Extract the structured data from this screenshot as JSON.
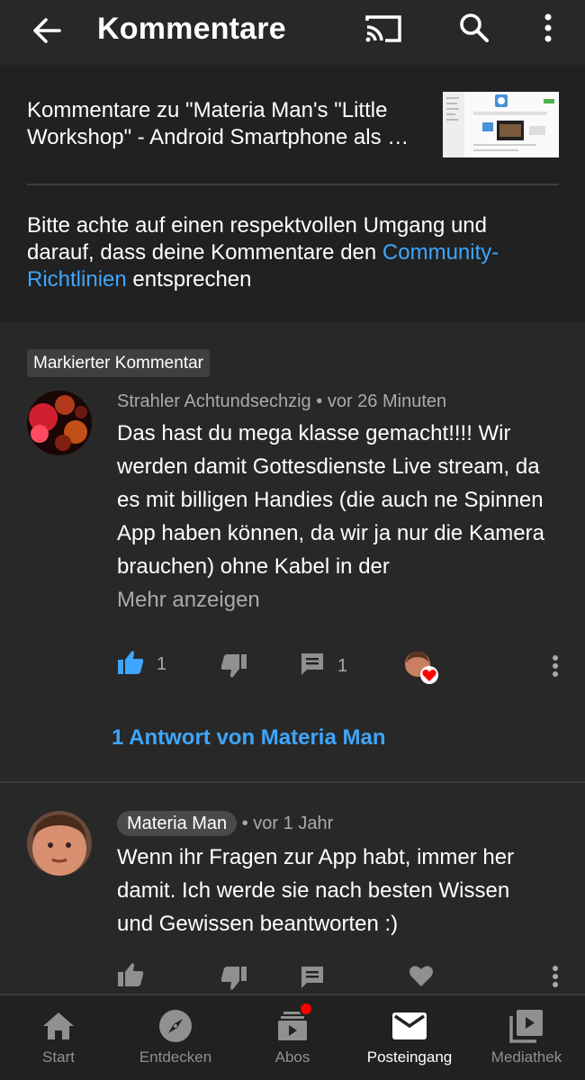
{
  "appbar": {
    "title": "Kommentare"
  },
  "header": {
    "video_ref": "Kommentare zu \"Materia Man's \"Little Workshop\" - Android Smartphone als …",
    "notice_prefix": "Bitte achte auf einen respektvollen Umgang und darauf, dass deine Kommentare den ",
    "notice_link": "Community-Richtlinien",
    "notice_suffix": " entsprechen"
  },
  "pinned_badge": "Markierter Kommentar",
  "comments": [
    {
      "author": "Strahler Achtundsechzig",
      "time": "vor 26 Minuten",
      "text": "Das hast du mega klasse gemacht!!!! Wir werden damit Gottesdienste Live stream, da es mit billigen Handies (die auch ne Spinnen App haben können, da wir ja nur die Kamera brauchen) ohne Kabel in der",
      "show_more": "Mehr anzeigen",
      "likes": "1",
      "replies": "1",
      "replies_link": "1 Antwort von Materia Man"
    },
    {
      "author": "Materia Man",
      "time": "vor 1 Jahr",
      "text": "Wenn ihr Fragen zur App habt, immer her damit. Ich werde sie nach besten Wissen und Gewissen beantworten :)"
    }
  ],
  "meta_separator": "•",
  "bottom_nav": [
    {
      "label": "Start",
      "icon": "home-icon"
    },
    {
      "label": "Entdecken",
      "icon": "compass-icon"
    },
    {
      "label": "Abos",
      "icon": "subscriptions-icon"
    },
    {
      "label": "Posteingang",
      "icon": "inbox-icon",
      "active": true
    },
    {
      "label": "Mediathek",
      "icon": "library-icon"
    }
  ],
  "colors": {
    "background": "#282828",
    "panel": "#212121",
    "link": "#3ea6ff",
    "like_active": "#3ea6ff",
    "heart": "#ff0000"
  }
}
